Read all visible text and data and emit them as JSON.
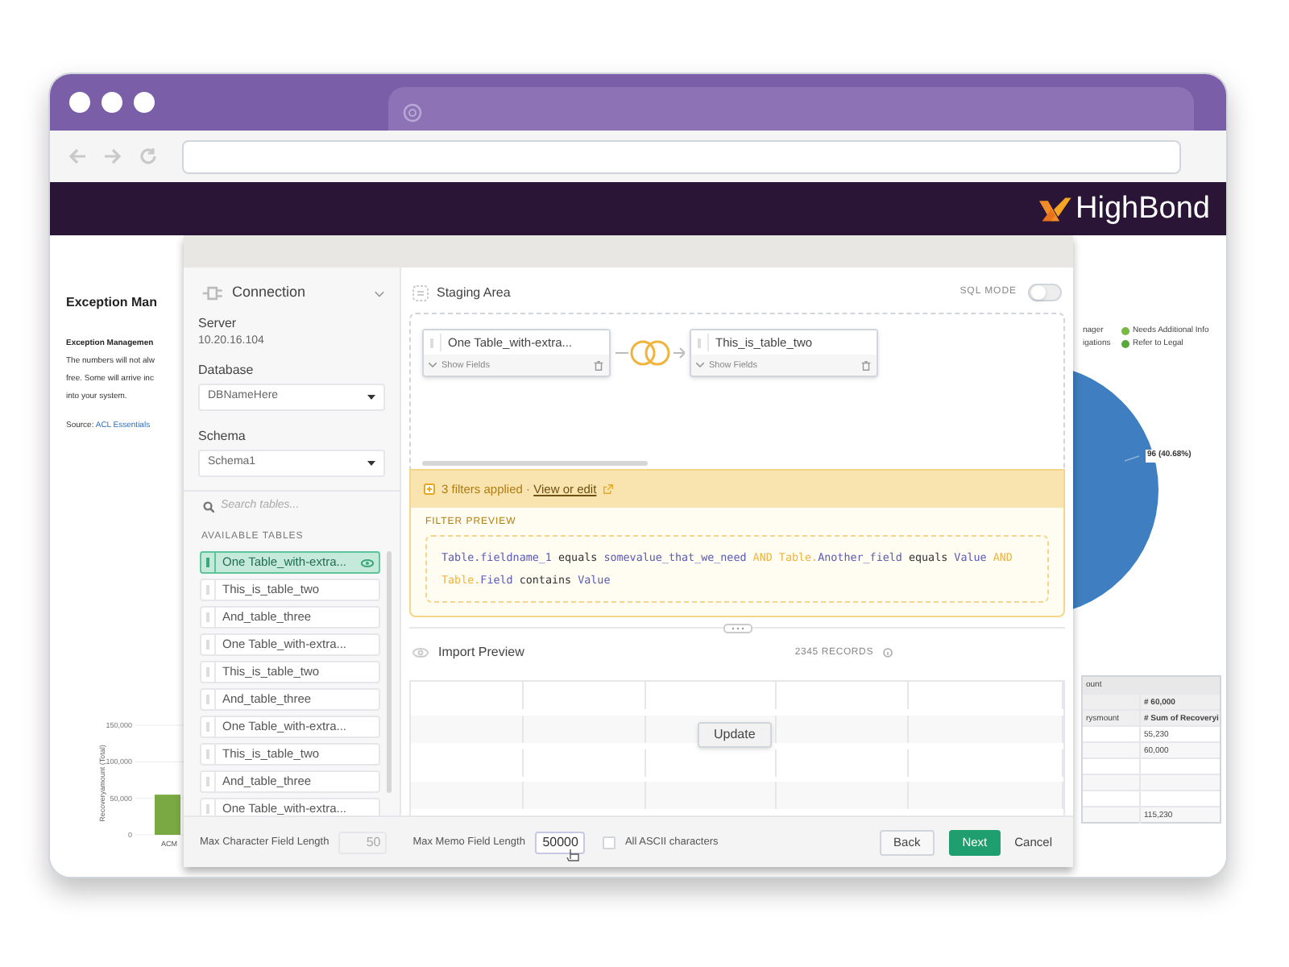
{
  "browser": {
    "logo_text": "HighBond"
  },
  "page": {
    "heading": "Exception Man",
    "lines": [
      {
        "kind": "bold",
        "text": "Exception Managemen"
      },
      {
        "kind": "plain",
        "text": "The numbers will not alw"
      },
      {
        "kind": "plain",
        "text": "free. Some will arrive inc"
      },
      {
        "kind": "plain",
        "text": "into your system."
      }
    ],
    "source": {
      "label": "Source:",
      "link": "ACL Essentials"
    },
    "chart_data": {
      "type": "bar",
      "ylim": [
        0,
        150000
      ],
      "ylabel": "Recoveryamount (Total)",
      "categories": [
        "ACM"
      ],
      "values": [
        55000
      ],
      "yticks": [
        0,
        {
          "value": 50000,
          "label": "50,000"
        },
        {
          "value": 100000,
          "label": "100,000"
        },
        {
          "value": 150000,
          "label": "150,000"
        }
      ]
    },
    "legend": [
      {
        "label": "nager"
      },
      {
        "label": "Needs Additional Info",
        "color": "#78b943"
      },
      {
        "label": "igations"
      },
      {
        "label": "Refer to Legal",
        "color": "#5aa83c"
      }
    ],
    "pie_label": "96 (40.68%)",
    "summary_table": {
      "header": "ount",
      "rows": [
        {
          "column_2": "# 60,000"
        },
        {
          "column_1": "rysmount",
          "column_2": "# Sum of Recoveryi"
        },
        {
          "column_2": "55,230"
        },
        {
          "column_2": "60,000"
        },
        {},
        {},
        {},
        {
          "column_2": "115,230"
        }
      ]
    }
  },
  "dialog": {
    "connection": {
      "title": "Connection",
      "server_label": "Server",
      "server": "10.20.16.104",
      "database_label": "Database",
      "database": "DBNameHere",
      "schema_label": "Schema",
      "schema": "Schema1"
    },
    "search": {
      "placeholder": "Search tables..."
    },
    "tables_heading": "AVAILABLE TABLES",
    "tables": [
      {
        "name": "One Table_with-extra...",
        "selected": true
      },
      {
        "name": "This_is_table_two",
        "selected": false
      },
      {
        "name": "And_table_three",
        "selected": false
      },
      {
        "name": "One Table_with-extra...",
        "selected": false
      },
      {
        "name": "This_is_table_two",
        "selected": false
      },
      {
        "name": "And_table_three",
        "selected": false
      },
      {
        "name": "One Table_with-extra...",
        "selected": false
      },
      {
        "name": "This_is_table_two",
        "selected": false
      },
      {
        "name": "And_table_three",
        "selected": false
      },
      {
        "name": "One Table_with-extra...",
        "selected": false
      }
    ],
    "staging": {
      "title": "Staging Area",
      "sql_mode": {
        "label": "SQL MODE",
        "on": false
      },
      "cards": [
        {
          "name": "One Table_with-extra...",
          "action": "Show Fields"
        },
        {
          "name": "This_is_table_two",
          "action": "Show Fields"
        }
      ]
    },
    "filters": {
      "summary": "3 filters applied ·",
      "link": "View or edit",
      "preview_label": "FILTER PREVIEW",
      "tokens": [
        {
          "kind": "field",
          "text": "Table.fieldname_1"
        },
        {
          "kind": "op",
          "text": "equals"
        },
        {
          "kind": "field",
          "text": "somevalue_that_we_need"
        },
        {
          "kind": "keyword",
          "text": "AND"
        },
        {
          "kind": "keyword",
          "text": "Table."
        },
        {
          "kind": "field",
          "text": "Another_field"
        },
        {
          "kind": "op",
          "text": "equals"
        },
        {
          "kind": "field",
          "text": "Value"
        },
        {
          "kind": "keyword",
          "text": "AND"
        },
        {
          "kind": "keyword",
          "text": "Table."
        },
        {
          "kind": "field",
          "text": "Field"
        },
        {
          "kind": "op",
          "text": "contains"
        },
        {
          "kind": "field",
          "text": "Value"
        }
      ]
    },
    "import_preview": {
      "title": "Import Preview",
      "records": "2345 RECORDS",
      "update_button": "Update"
    },
    "footer": {
      "max_char": {
        "label": "Max Character Field Length",
        "value": "50",
        "disabled": true
      },
      "max_memo": {
        "label": "Max Memo Field Length",
        "value": "50000",
        "disabled": false
      },
      "ascii": {
        "label": "All ASCII characters",
        "checked": false
      },
      "buttons": [
        {
          "label": "Back",
          "kind": "secondary"
        },
        {
          "label": "Next",
          "kind": "primary"
        },
        {
          "label": "Cancel",
          "kind": "link"
        }
      ]
    }
  }
}
